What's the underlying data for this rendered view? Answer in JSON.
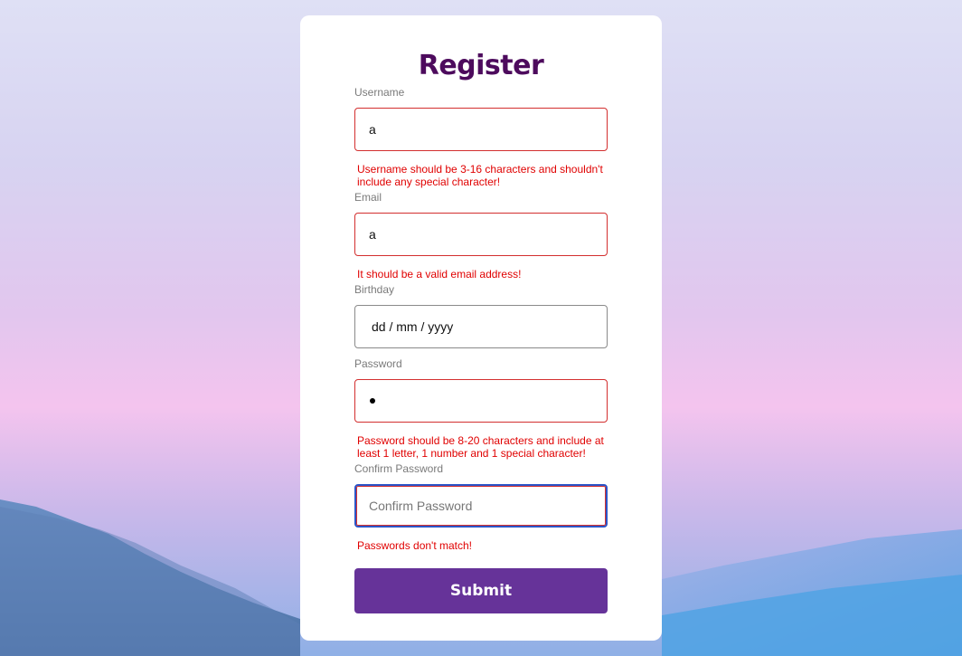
{
  "form": {
    "title": "Register",
    "submit_label": "Submit"
  },
  "fields": {
    "username": {
      "label": "Username",
      "value": "a",
      "error": "Username should be 3-16 characters and shouldn't include any special character!"
    },
    "email": {
      "label": "Email",
      "value": "a",
      "error": "It should be a valid email address!"
    },
    "birthday": {
      "label": "Birthday",
      "value": "dd / mm / yyyy"
    },
    "password": {
      "label": "Password",
      "error": "Password should be 8-20 characters and include at least 1 letter, 1 number and 1 special character!"
    },
    "confirm_password": {
      "label": "Confirm Password",
      "placeholder": "Confirm Password",
      "value": "",
      "error": "Passwords don't match!"
    }
  },
  "colors": {
    "title": "#4d0b5d",
    "button": "#663399",
    "error": "#e00000",
    "focus": "#2c55c8"
  }
}
